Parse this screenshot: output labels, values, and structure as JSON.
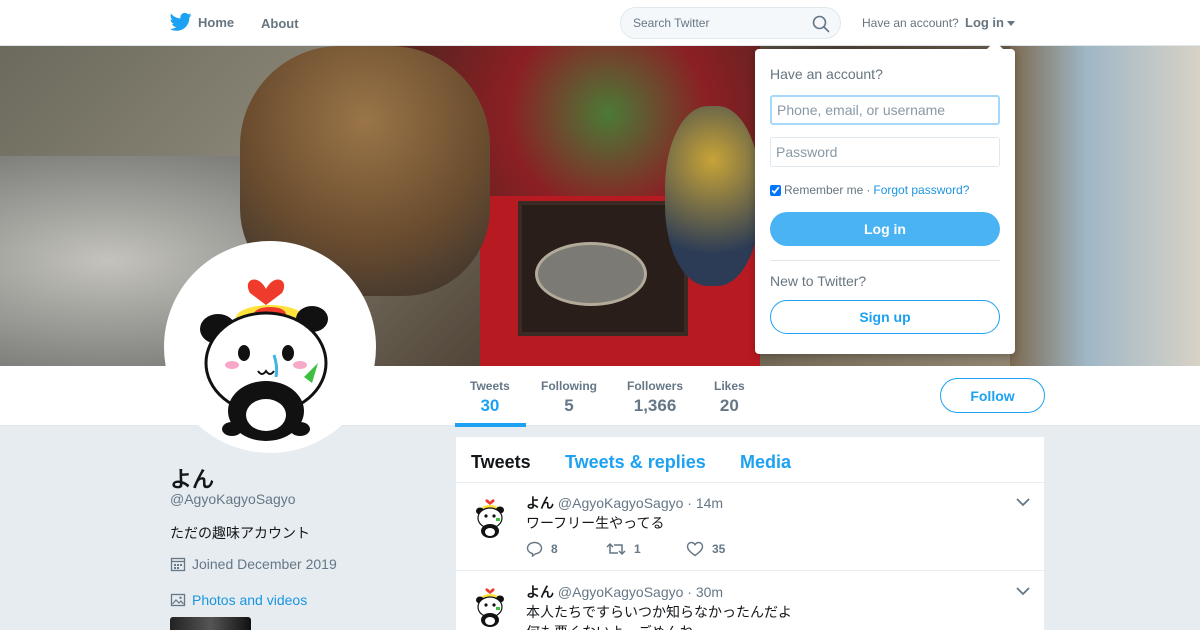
{
  "nav": {
    "home_label": "Home",
    "about_label": "About",
    "search_placeholder": "Search Twitter",
    "have_account": "Have an account?",
    "login_label": "Log in",
    "brand_color": "#1da1f2"
  },
  "profile": {
    "name": "よん",
    "handle": "@AgyoKagyoSagyo",
    "bio": "ただの趣味アカウント",
    "joined": "Joined December 2019",
    "photos_link": "Photos and videos",
    "follow_label": "Follow"
  },
  "stats": [
    {
      "label": "Tweets",
      "value": "30"
    },
    {
      "label": "Following",
      "value": "5"
    },
    {
      "label": "Followers",
      "value": "1,366"
    },
    {
      "label": "Likes",
      "value": "20"
    }
  ],
  "timeline": {
    "tabs": [
      "Tweets",
      "Tweets & replies",
      "Media"
    ],
    "tweets": [
      {
        "name": "よん",
        "handle": "@AgyoKagyoSagyo",
        "time": "· 14m",
        "text_lines": [
          "ワーフリー生やってる"
        ],
        "replies": "8",
        "retweets": "1",
        "likes": "35"
      },
      {
        "name": "よん",
        "handle": "@AgyoKagyoSagyo",
        "time": "· 30m",
        "text_lines": [
          "本人たちですらいつか知らなかったんだよ",
          "何も悪くないよ、ごめんね"
        ],
        "replies": "",
        "retweets": "",
        "likes": ""
      }
    ]
  },
  "login_popup": {
    "title": "Have an account?",
    "username_placeholder": "Phone, email, or username",
    "password_placeholder": "Password",
    "remember_label": "Remember me",
    "separator": "·",
    "forgot_label": "Forgot password?",
    "login_button": "Log in",
    "new_label": "New to Twitter?",
    "signup_button": "Sign up"
  },
  "icons": {
    "logo": "twitter-bird-icon",
    "search": "search-icon",
    "calendar": "calendar-icon",
    "photos": "image-icon",
    "reply": "reply-icon",
    "retweet": "retweet-icon",
    "like": "heart-icon",
    "caret": "chevron-down-icon"
  }
}
